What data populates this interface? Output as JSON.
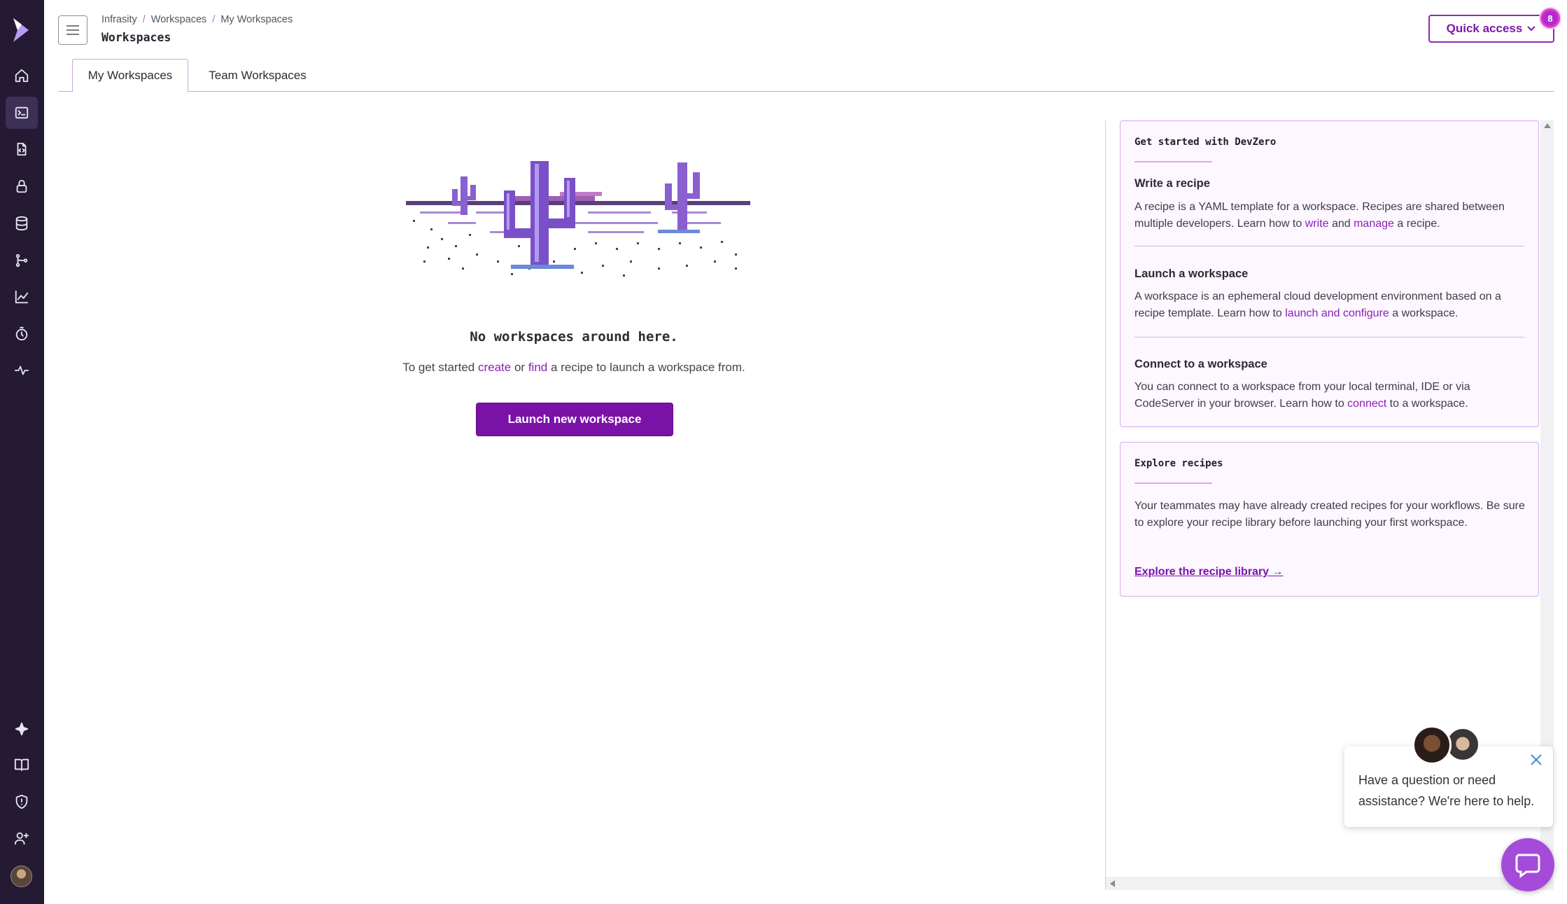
{
  "breadcrumb": {
    "org": "Infrasity",
    "section": "Workspaces",
    "current": "My Workspaces",
    "separator": "/"
  },
  "page": {
    "title": "Workspaces"
  },
  "header": {
    "quick_access_label": "Quick access",
    "quick_access_badge": "8"
  },
  "tabs": [
    {
      "label": "My Workspaces",
      "active": true
    },
    {
      "label": "Team Workspaces",
      "active": false
    }
  ],
  "sidebar": {
    "items": [
      {
        "icon": "home-icon"
      },
      {
        "icon": "terminal-icon",
        "active": true
      },
      {
        "icon": "file-code-icon"
      },
      {
        "icon": "lock-icon"
      },
      {
        "icon": "database-icon"
      },
      {
        "icon": "git-branch-icon"
      },
      {
        "icon": "chart-icon"
      },
      {
        "icon": "timer-icon"
      },
      {
        "icon": "activity-icon"
      },
      {
        "icon": "sparkle-icon"
      },
      {
        "icon": "book-icon"
      },
      {
        "icon": "shield-icon"
      },
      {
        "icon": "user-plus-icon"
      }
    ]
  },
  "empty_state": {
    "title": "No workspaces around here.",
    "desc_start": "To get started",
    "link_create": "create",
    "desc_or": "or",
    "link_find": "find",
    "desc_end": "a recipe to launch a workspace from.",
    "button_label": "Launch new workspace"
  },
  "get_started": {
    "title": "Get started with DevZero",
    "recipe": {
      "title": "Write a recipe",
      "text_start": "A recipe is a YAML template for a workspace. Recipes are shared between multiple developers. Learn how to",
      "link_write": "write",
      "text_and": "and",
      "link_manage": "manage",
      "text_end": "a recipe."
    },
    "launch": {
      "title": "Launch a workspace",
      "text_start": "A workspace is an ephemeral cloud development environment based on a recipe template. Learn how to",
      "link": "launch and configure",
      "text_end": "a workspace."
    },
    "connect": {
      "title": "Connect to a workspace",
      "text_start": "You can connect to a workspace from your local terminal, IDE or via CodeServer in your browser. Learn how to",
      "link": "connect",
      "text_end": "to a workspace."
    }
  },
  "explore": {
    "title": "Explore recipes",
    "text": "Your teammates may have already created recipes for your workflows. Be sure to explore your recipe library before launching your first workspace.",
    "link": "Explore the recipe library →"
  },
  "chat": {
    "message": "Have a question or need assistance? We're here to help."
  },
  "colors": {
    "sidebar_bg": "#241a33",
    "accent": "#7b12a8",
    "card_bg": "#fdf7ff",
    "card_border": "#d9a8ec"
  }
}
